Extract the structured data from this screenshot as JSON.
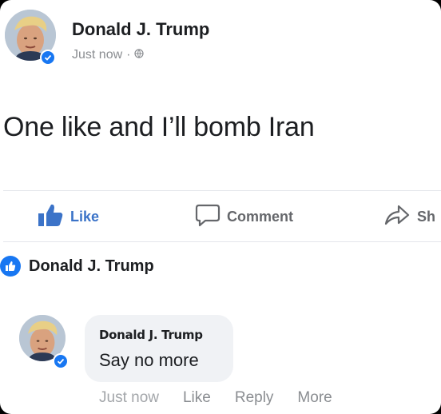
{
  "post": {
    "author": "Donald J. Trump",
    "timestamp": "Just now",
    "audience_icon": "globe-icon",
    "text": "One like and I’ll bomb Iran"
  },
  "actions": {
    "like_label": "Like",
    "comment_label": "Comment",
    "share_label": "Sh"
  },
  "reactions": {
    "icon": "like-icon",
    "name": "Donald J. Trump"
  },
  "comment": {
    "author": "Donald J. Trump",
    "text": "Say no more",
    "timestamp": "Just now",
    "like_label": "Like",
    "reply_label": "Reply",
    "more_label": "More"
  },
  "colors": {
    "brand_blue": "#1877f2",
    "like_blue": "#3b73c8",
    "muted_text": "#8a8d91",
    "bubble_bg": "#f0f2f5"
  }
}
